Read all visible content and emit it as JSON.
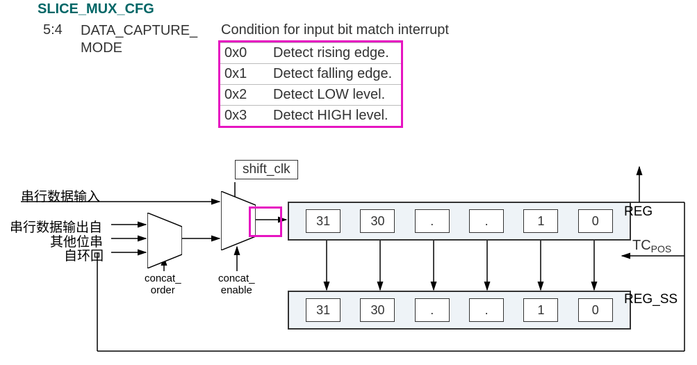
{
  "register_name": "SLICE_MUX_CFG",
  "field_bits": "5:4",
  "field_name_l1": "DATA_CAPTURE_",
  "field_name_l2": "MODE",
  "description": "Condition for input bit match interrupt",
  "options": [
    {
      "key": "0x0",
      "val": "Detect rising edge."
    },
    {
      "key": "0x1",
      "val": "Detect falling edge."
    },
    {
      "key": "0x2",
      "val": "Detect LOW level."
    },
    {
      "key": "0x3",
      "val": "Detect HIGH level."
    }
  ],
  "diagram": {
    "shift_clk_label": "shift_clk",
    "serial_in_label": "串行数据输入",
    "mux1_in1": "串行数据输出自",
    "mux1_in2": "其他位串",
    "mux1_in3": "自环回",
    "mux1_ctrl": "concat_\norder",
    "mux2_ctrl": "concat_\nenable",
    "reg_label": "REG",
    "regss_label": "REG_SS",
    "tc_label_main": "TC",
    "tc_label_sub": "POS",
    "cells": [
      "31",
      "30",
      ".",
      ".",
      "1",
      "0"
    ]
  }
}
